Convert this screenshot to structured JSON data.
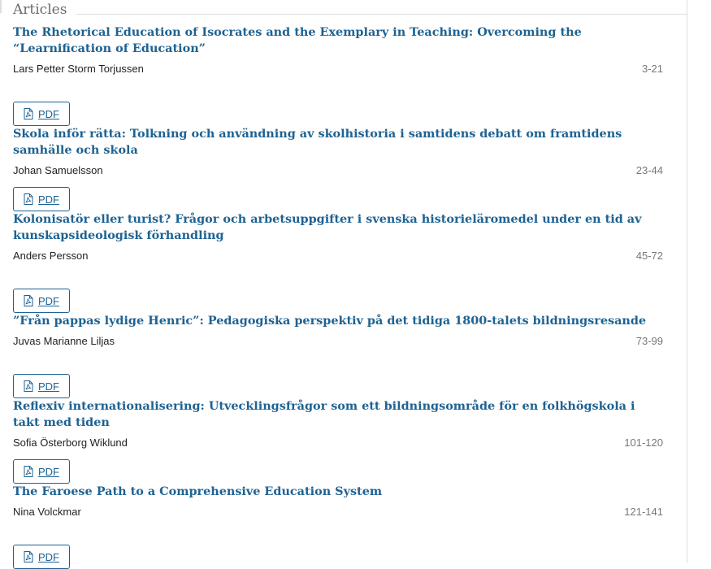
{
  "section": {
    "title": "Articles"
  },
  "articles": [
    {
      "title": "The Rhetorical Education of Isocrates and the Exemplary in Teaching: Overcoming the “Learnification of Education”",
      "author": "Lars Petter Storm Torjussen",
      "pages": "3-21",
      "galley_label": "PDF",
      "galley_icon": "file-pdf-icon"
    },
    {
      "title": "Skola inför rätta: Tolkning och användning av skolhistoria i samtidens debatt om framtidens samhälle och skola",
      "author": "Johan Samuelsson",
      "pages": "23-44",
      "galley_label": "PDF",
      "galley_icon": "file-pdf-icon"
    },
    {
      "title": "Kolonisatör eller turist? Frågor och arbetsuppgifter i svenska historieläromedel under en tid av kunskapsideologisk förhandling",
      "author": "Anders Persson",
      "pages": "45-72",
      "galley_label": "PDF",
      "galley_icon": "file-pdf-icon"
    },
    {
      "title": "”Från pappas lydige Henric”: Pedagogiska perspektiv på det tidiga 1800-talets bildningsresande",
      "author": "Juvas Marianne Liljas",
      "pages": "73-99",
      "galley_label": "PDF",
      "galley_icon": "file-pdf-icon"
    },
    {
      "title": "Reflexiv internationalisering: Utvecklingsfrågor som ett bildningsområde för en folkhögskola i takt med tiden",
      "author": "Sofia Österborg Wiklund",
      "pages": "101-120",
      "galley_label": "PDF",
      "galley_icon": "file-pdf-icon"
    },
    {
      "title": "The Faroese Path to a Comprehensive Education System",
      "author": "Nina Volckmar",
      "pages": "121-141",
      "galley_label": "PDF",
      "galley_icon": "file-pdf-icon"
    }
  ],
  "colors": {
    "link": "#1e6292",
    "text": "#222222",
    "muted": "#777777",
    "rule": "#dddddd"
  }
}
